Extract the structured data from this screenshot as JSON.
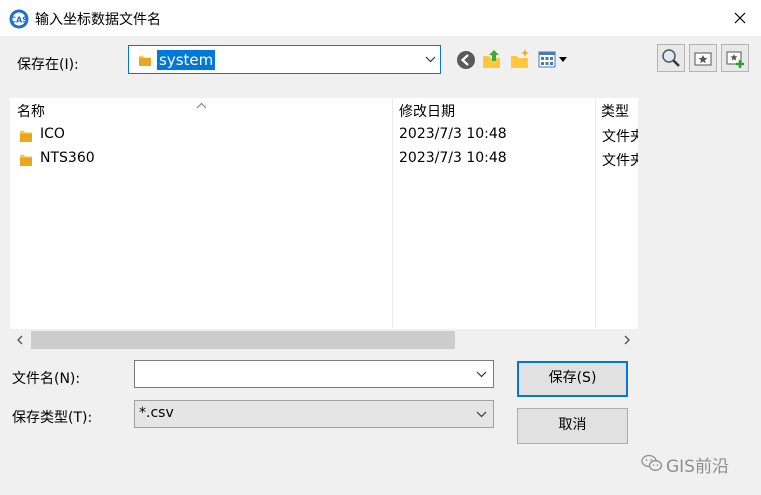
{
  "window": {
    "title": "输入坐标数据文件名",
    "icon": "app-logo-icon",
    "close_icon": "close-icon"
  },
  "location": {
    "label": "保存在(I):",
    "current_folder": "system",
    "folder_icon": "folder-icon"
  },
  "toolbar": [
    {
      "name": "back-button",
      "icon": "back-arrow-icon"
    },
    {
      "name": "up-folder-button",
      "icon": "up-folder-icon"
    },
    {
      "name": "new-folder-button",
      "icon": "new-folder-icon"
    },
    {
      "name": "view-menu-button",
      "icon": "view-menu-icon"
    }
  ],
  "extra_buttons": [
    {
      "name": "search-button",
      "icon": "search-icon"
    },
    {
      "name": "favorites-button",
      "icon": "star-folder-icon"
    },
    {
      "name": "add-favorite-button",
      "icon": "add-favorite-icon"
    }
  ],
  "file_list": {
    "columns": [
      "名称",
      "修改日期",
      "类型"
    ],
    "rows": [
      {
        "name": "ICO",
        "date": "2023/7/3 10:48",
        "type": "文件夹"
      },
      {
        "name": "NTS360",
        "date": "2023/7/3 10:48",
        "type": "文件夹"
      }
    ]
  },
  "form": {
    "filename_label": "文件名(N):",
    "filename_value": "",
    "filetype_label": "保存类型(T):",
    "filetype_value": "*.csv"
  },
  "buttons": {
    "save": "保存(S)",
    "cancel": "取消"
  },
  "watermark": {
    "text": "GIS前沿",
    "icon": "wechat-icon"
  },
  "colors": {
    "accent": "#0078d7",
    "folder": "#ffc83d",
    "background": "#f0f0f0"
  }
}
